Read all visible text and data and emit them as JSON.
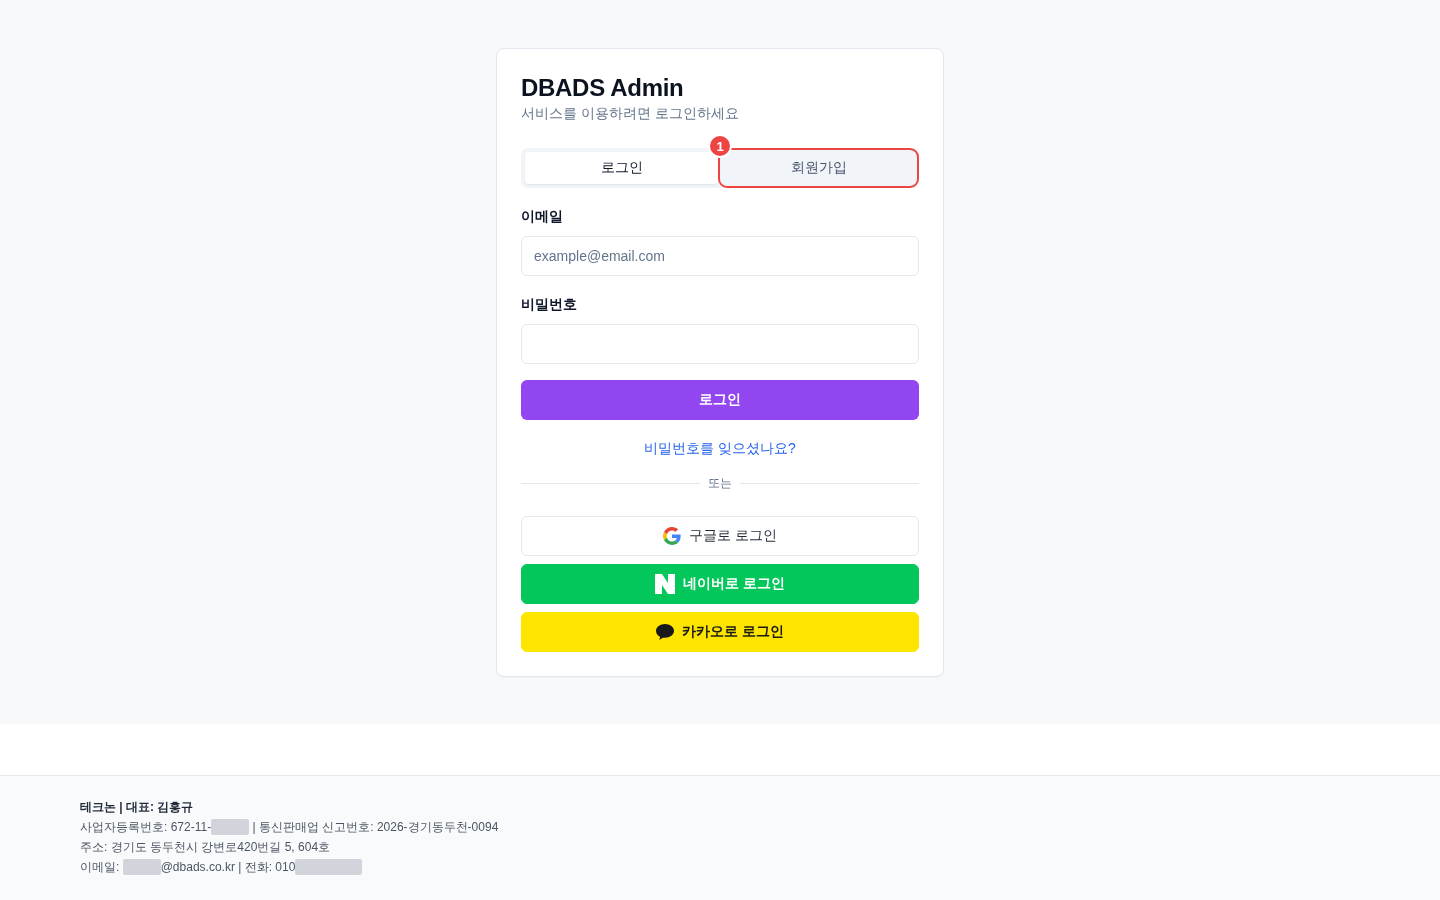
{
  "card": {
    "title": "DBADS Admin",
    "subtitle": "서비스를 이용하려면 로그인하세요"
  },
  "tabs": [
    {
      "label": "로그인",
      "selected": true,
      "highlighted": false
    },
    {
      "label": "회원가입",
      "selected": false,
      "highlighted": true,
      "marker": "1"
    }
  ],
  "fields": [
    {
      "label": "이메일",
      "placeholder": "example@email.com"
    },
    {
      "label": "비밀번호"
    }
  ],
  "submit_button": "로그인",
  "forgot_link": "비밀번호를 잊으셨나요?",
  "divider_text": "또는",
  "social_buttons": [
    {
      "kind": "google",
      "label": "구글로 로그인"
    },
    {
      "kind": "naver",
      "label": "네이버로 로그인"
    },
    {
      "kind": "kakao",
      "label": "카카오로 로그인"
    }
  ],
  "footer": {
    "lines": [
      [
        {
          "kind": "strong",
          "text": "테크논 | 대표: 김홍규"
        }
      ],
      [
        {
          "kind": "text",
          "text": "사업자등록번호: 672-11-"
        },
        {
          "kind": "redaction"
        },
        {
          "kind": "text",
          "text": " | 통신판매업 신고번호: 2026-경기동두천-0094"
        }
      ],
      [
        {
          "kind": "text",
          "text": "주소: 경기도 동두천시 강변로420번길 5, 604호"
        }
      ],
      [
        {
          "kind": "text",
          "text": "이메일: "
        },
        {
          "kind": "redaction"
        },
        {
          "kind": "text",
          "text": "@dbads.co.kr | 전화: 010"
        },
        {
          "kind": "wide_redaction"
        }
      ]
    ]
  }
}
